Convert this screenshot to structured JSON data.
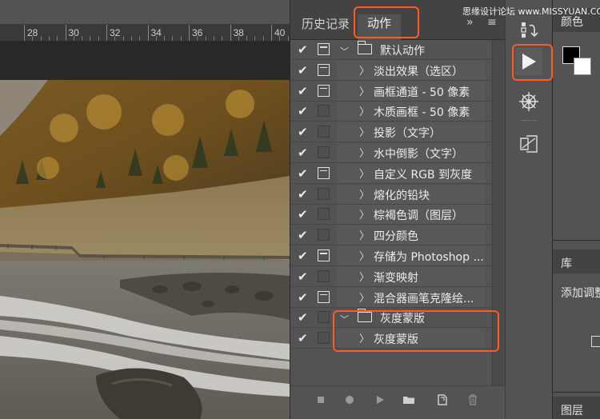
{
  "ruler": {
    "ticks": [
      "28",
      "30",
      "32",
      "34",
      "36",
      "38",
      "40"
    ]
  },
  "actions_panel": {
    "tabs": [
      {
        "label": "历史记录"
      },
      {
        "label": "动作"
      }
    ],
    "menu_glyphs": {
      "collapse": "»",
      "menu": "≡"
    },
    "rows": [
      {
        "label": "默认动作",
        "kind": "set",
        "expanded": true,
        "checked": true,
        "dialog": true
      },
      {
        "label": "淡出效果（选区）",
        "kind": "action",
        "checked": true,
        "dialog": true
      },
      {
        "label": "画框通道 - 50 像素",
        "kind": "action",
        "checked": true,
        "dialog": true
      },
      {
        "label": "木质画框 - 50 像素",
        "kind": "action",
        "checked": true,
        "dialog": false
      },
      {
        "label": "投影（文字）",
        "kind": "action",
        "checked": true,
        "dialog": false
      },
      {
        "label": "水中倒影（文字）",
        "kind": "action",
        "checked": true,
        "dialog": false
      },
      {
        "label": "自定义 RGB 到灰度",
        "kind": "action",
        "checked": true,
        "dialog": true
      },
      {
        "label": "熔化的铅块",
        "kind": "action",
        "checked": true,
        "dialog": false
      },
      {
        "label": "棕褐色调（图层）",
        "kind": "action",
        "checked": true,
        "dialog": false
      },
      {
        "label": "四分颜色",
        "kind": "action",
        "checked": true,
        "dialog": false
      },
      {
        "label": "存储为 Photoshop ...",
        "kind": "action",
        "checked": true,
        "dialog": true
      },
      {
        "label": "渐变映射",
        "kind": "action",
        "checked": true,
        "dialog": false
      },
      {
        "label": "混合器画笔克隆绘...",
        "kind": "action",
        "checked": true,
        "dialog": true
      },
      {
        "label": "灰度蒙版",
        "kind": "set",
        "expanded": true,
        "checked": true,
        "dialog": false
      },
      {
        "label": "灰度蒙版",
        "kind": "action",
        "checked": true,
        "dialog": false
      }
    ],
    "bottom_buttons": [
      "stop-icon",
      "record-icon",
      "play-icon",
      "new-set-icon",
      "new-action-icon",
      "trash-icon"
    ]
  },
  "icon_strip": [
    "history-icon",
    "actions-play-icon",
    "navigator-icon",
    "properties-icon"
  ],
  "right_panels": {
    "color_tab": "颜色",
    "library_tab": "库",
    "adjustments_label": "添加调整",
    "layers_tab": "图层"
  },
  "watermark": "思缘设计论坛 www.MISSYUAN.COM",
  "colors": {
    "highlight": "#ff5a1f",
    "panel_bg": "#535353",
    "tab_bg": "#434343"
  }
}
